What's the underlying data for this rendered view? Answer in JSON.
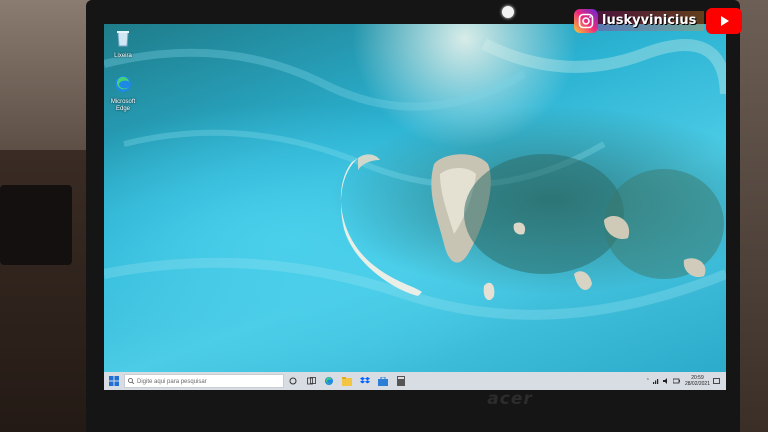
{
  "overlay": {
    "handle": "luskyvinicius",
    "instagram_icon": "instagram-icon",
    "youtube_icon": "youtube-icon"
  },
  "desktop": {
    "icons": [
      {
        "label": "Lixeira",
        "icon": "recycle-bin-icon"
      },
      {
        "label": "Microsoft Edge",
        "icon": "edge-icon"
      }
    ]
  },
  "taskbar": {
    "search_placeholder": "Digite aqui para pesquisar",
    "pinned": [
      "cortana-icon",
      "task-view-icon",
      "edge-icon",
      "file-explorer-icon",
      "dropbox-icon",
      "store-icon",
      "calculator-icon"
    ],
    "clock_time": "20:59",
    "clock_date": "28/02/2021"
  },
  "laptop": {
    "brand": "acer"
  },
  "colors": {
    "taskbar": "#d8dde3",
    "sea": "#2bb2d2",
    "youtube": "#ff0000"
  }
}
